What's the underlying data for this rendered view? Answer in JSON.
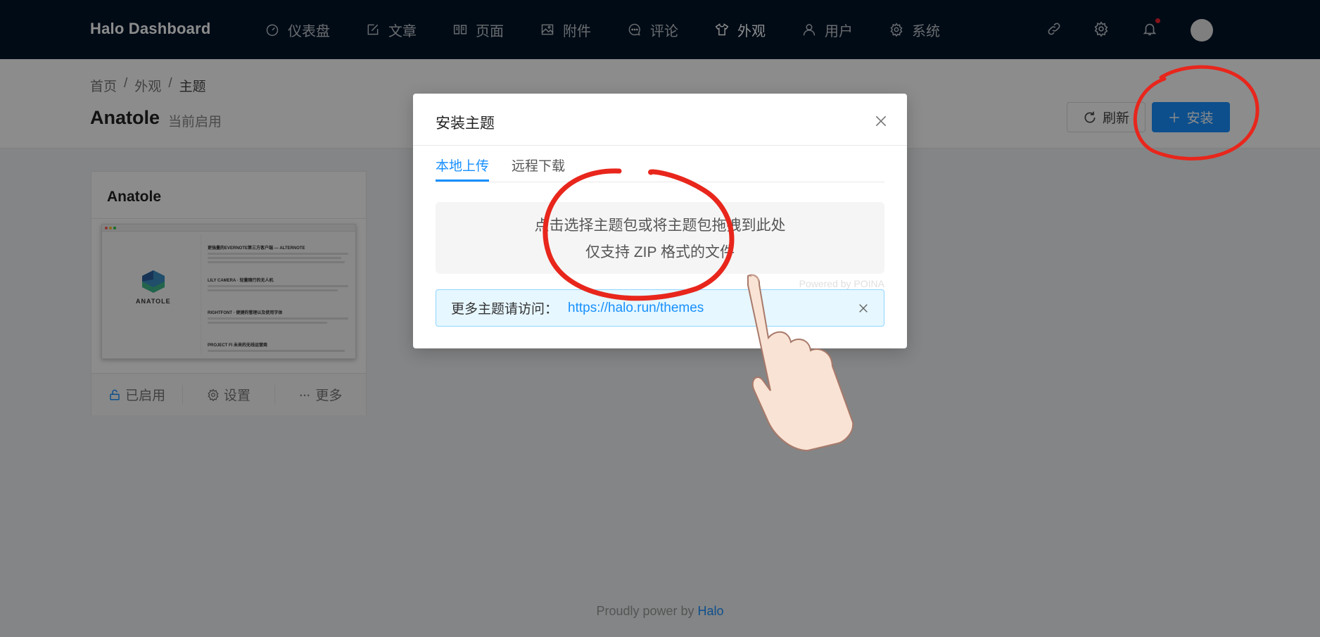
{
  "app": {
    "logo": "Halo  Dashboard"
  },
  "nav": {
    "items": [
      {
        "label": "仪表盘",
        "icon": "dashboard-icon"
      },
      {
        "label": "文章",
        "icon": "edit-icon"
      },
      {
        "label": "页面",
        "icon": "read-icon"
      },
      {
        "label": "附件",
        "icon": "picture-icon"
      },
      {
        "label": "评论",
        "icon": "message-icon"
      },
      {
        "label": "外观",
        "icon": "skin-icon",
        "active": true
      },
      {
        "label": "用户",
        "icon": "user-icon"
      },
      {
        "label": "系统",
        "icon": "setting-icon"
      }
    ],
    "right_icons": [
      "link-icon",
      "gear-icon",
      "bell-icon",
      "avatar"
    ]
  },
  "breadcrumb": {
    "home": "首页",
    "appearance": "外观",
    "current": "主题",
    "sep": "/"
  },
  "page": {
    "title": "Anatole",
    "subtitle": "当前启用",
    "refresh_label": "刷新",
    "install_label": "安装"
  },
  "card": {
    "title": "Anatole",
    "cover": {
      "brand": "ANATOLE",
      "posts": [
        "更強量的EVERNOTE第三方客户端 — ALTERNOTE",
        "LILY CAMERA · 轻量随行的无人机",
        "RIGHTFONT · 便捷的管理以及使用字体",
        "PROJECT FI 未来的无线运营商"
      ]
    },
    "actions": {
      "enabled": "已启用",
      "settings": "设置",
      "more": "更多"
    }
  },
  "modal": {
    "title": "安装主题",
    "tabs": [
      {
        "label": "本地上传",
        "active": true
      },
      {
        "label": "远程下载",
        "active": false
      }
    ],
    "upload_text_1": "点击选择主题包或将主题包拖拽到此处",
    "upload_text_2": "仅支持 ZIP 格式的文件",
    "powered": "Powered by POINA",
    "alert_text": "更多主题请访问：",
    "alert_link": "https://halo.run/themes"
  },
  "footer": {
    "text": "Proudly power by ",
    "link": "Halo"
  },
  "colors": {
    "nav_bg": "#001529",
    "primary": "#1890ff",
    "annotation": "#e8261c"
  }
}
